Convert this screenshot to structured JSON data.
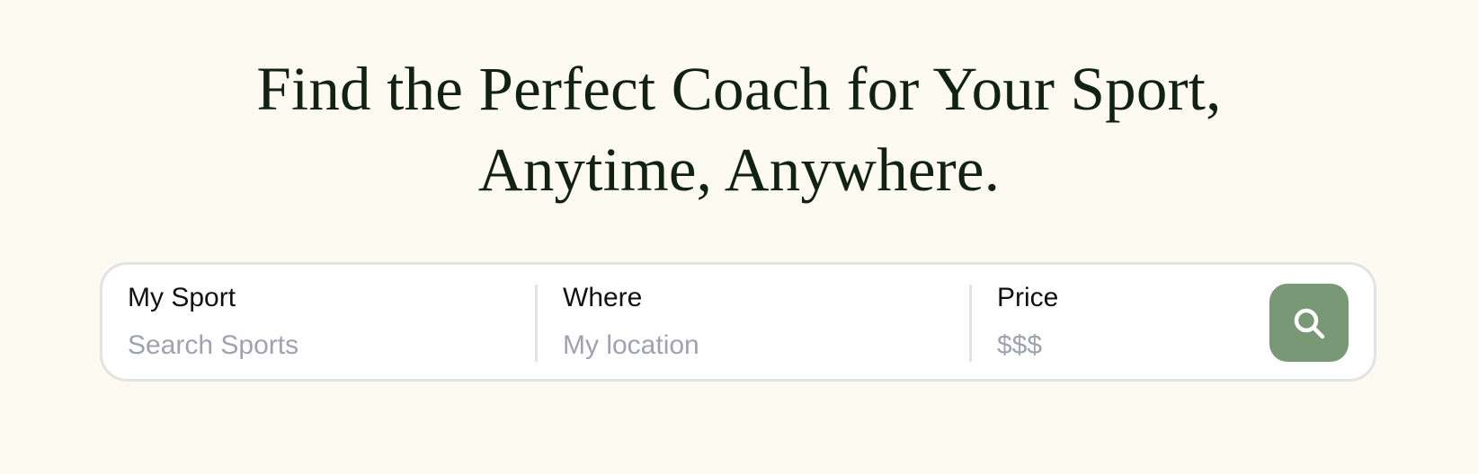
{
  "hero": {
    "title_line_1": "Find the Perfect Coach for Your Sport,",
    "title_line_2": "Anytime, Anywhere."
  },
  "search": {
    "sport": {
      "label": "My Sport",
      "placeholder": "Search Sports",
      "value": ""
    },
    "where": {
      "label": "Where",
      "placeholder": "My location",
      "value": ""
    },
    "price": {
      "label": "Price",
      "placeholder": "$$$",
      "value": ""
    },
    "button": {
      "icon": "search-icon",
      "aria_label": "Search"
    }
  },
  "colors": {
    "page_background": "#fdfbf1",
    "heading_text": "#112211",
    "search_button": "#789876",
    "placeholder_text": "#9ea3ad",
    "border": "#e2e3e3"
  }
}
